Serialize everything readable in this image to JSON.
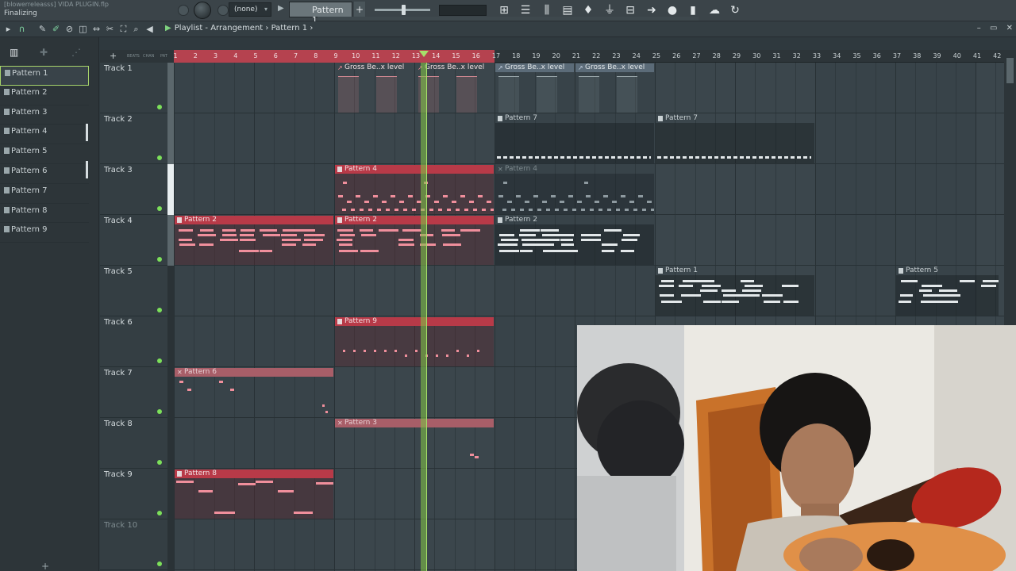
{
  "window": {
    "file_title": "[blowerreleasss] VIDA PLUGIN.flp",
    "status": "Finalizing"
  },
  "toolbar": {
    "preset": "(none)",
    "pattern_selector": "Pattern 1",
    "pattern_add": "+",
    "icons": [
      "snap-icon",
      "mixer-icon",
      "channel-rack-icon",
      "piano-roll-icon",
      "browser-icon",
      "plugin-picker-icon",
      "touch-keyboard-icon",
      "export-icon",
      "record-icon",
      "file-icon",
      "cloud-icon",
      "restore-icon"
    ]
  },
  "playlist": {
    "breadcrumb": [
      "Playlist - Arrangement",
      "Pattern 1"
    ],
    "breadcrumb_separator": "›",
    "window_controls": [
      "–",
      "▭",
      "✕"
    ],
    "ruler_header_labels": [
      "BEATS",
      "CHAN",
      "PAT"
    ],
    "ruler_plus": "+"
  },
  "patterns": [
    "Pattern 1",
    "Pattern 2",
    "Pattern 3",
    "Pattern 4",
    "Pattern 5",
    "Pattern 6",
    "Pattern 7",
    "Pattern 8",
    "Pattern 9"
  ],
  "selected_pattern": "Pattern 1",
  "picker": {
    "icons": [
      "piano-icon",
      "add-icon",
      "more-icon"
    ],
    "add": "+"
  },
  "tracks": [
    "Track 1",
    "Track 2",
    "Track 3",
    "Track 4",
    "Track 5",
    "Track 6",
    "Track 7",
    "Track 8",
    "Track 9",
    "Track 10"
  ],
  "bars": [
    1,
    2,
    3,
    4,
    5,
    6,
    7,
    8,
    9,
    10,
    11,
    12,
    13,
    14,
    15,
    16,
    17,
    18,
    19,
    20,
    21,
    22,
    23,
    24,
    25,
    26,
    27,
    28,
    29,
    30,
    31,
    32,
    33,
    34,
    35,
    36,
    37,
    38,
    39,
    40,
    41,
    42
  ],
  "loop_end_bar": 17,
  "playhead_bar": 13.3,
  "clips": [
    {
      "track": 1,
      "start": 9,
      "len": 4,
      "label": "Gross Be..x level",
      "style": "auto"
    },
    {
      "track": 1,
      "start": 13,
      "len": 4,
      "label": "Gross Be..x level",
      "style": "auto"
    },
    {
      "track": 1,
      "start": 17,
      "len": 4,
      "label": "Gross Be..x level",
      "style": "auto-grey"
    },
    {
      "track": 1,
      "start": 21,
      "len": 4,
      "label": "Gross Be..x level",
      "style": "auto-grey"
    },
    {
      "track": 2,
      "start": 17,
      "len": 8,
      "label": "Pattern 7",
      "style": "grey"
    },
    {
      "track": 2,
      "start": 25,
      "len": 8,
      "label": "Pattern 7",
      "style": "grey"
    },
    {
      "track": 3,
      "start": 9,
      "len": 8,
      "label": "Pattern 4",
      "style": "red"
    },
    {
      "track": 3,
      "start": 17,
      "len": 8,
      "label": "Pattern 4",
      "style": "muted-grey"
    },
    {
      "track": 4,
      "start": 1,
      "len": 8,
      "label": "Pattern 2",
      "style": "red"
    },
    {
      "track": 4,
      "start": 9,
      "len": 8,
      "label": "Pattern 2",
      "style": "red"
    },
    {
      "track": 4,
      "start": 17,
      "len": 8,
      "label": "Pattern 2",
      "style": "grey"
    },
    {
      "track": 5,
      "start": 25,
      "len": 8,
      "label": "Pattern 1",
      "style": "grey"
    },
    {
      "track": 5,
      "start": 37,
      "len": 5.2,
      "label": "Pattern 5",
      "style": "grey"
    },
    {
      "track": 6,
      "start": 9,
      "len": 8,
      "label": "Pattern 9",
      "style": "red"
    },
    {
      "track": 7,
      "start": 1,
      "len": 8,
      "label": "Pattern 6",
      "style": "muted"
    },
    {
      "track": 8,
      "start": 9,
      "len": 8,
      "label": "Pattern 3",
      "style": "muted"
    },
    {
      "track": 9,
      "start": 1,
      "len": 8,
      "label": "Pattern 8",
      "style": "red"
    }
  ],
  "colors": {
    "clip_red": "#b83a48",
    "note_pink": "#f08f9c",
    "playhead_green": "#a6e06a",
    "led_green": "#7ce05a"
  }
}
